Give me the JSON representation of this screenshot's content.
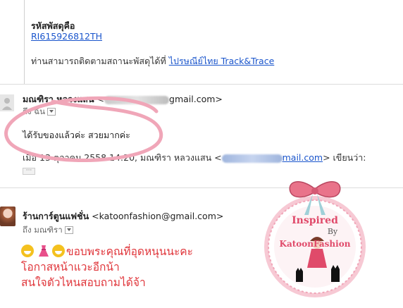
{
  "messages": {
    "quoted": {
      "heading": "รหัสพัสดุคือ",
      "tracking_number": "RI615926812TH",
      "note_text": "ท่านสามารถติดตามสถานะพัสดุได้ที่",
      "note_link": "ไปรษณีย์ไทย Track&Trace"
    },
    "reply": {
      "sender_name": "มณฑิรา หลวงแสน",
      "sender_email_prefix": "<",
      "sender_email_domain": "gmail.com>",
      "to_label": "ถึง ฉัน",
      "body": "ได้รับของแล้วค่ะ  สวยมากค่ะ",
      "quote_start": "เมื่อ 13 ตุลาคม 2558 14:20, มณฑิรา หลวงแสน <",
      "quote_domain": "mail.com",
      "quote_end": "> เขียนว่า:",
      "ellipsis": "···"
    },
    "shop": {
      "sender_name": "ร้านการ์ตูนแฟชั่น",
      "sender_email": "<katoonfashion@gmail.com>",
      "to_label": "ถึง มณฑิรา",
      "line1": "ขอบพระคุณที่อุดหนุนนะคะ",
      "line2": "โอกาสหน้าแวะอีกน้า",
      "line3": "สนใจตัวไหนสอบถามได้จ้า"
    }
  },
  "watermark": {
    "line1": "Inspired",
    "line2": "By",
    "line3": "KatoonFashion"
  },
  "colors": {
    "link": "#1a55cc",
    "shop_text": "#e0353a",
    "circle_annotation": "#f0a6b8",
    "badge_bow": "#e9738a"
  }
}
